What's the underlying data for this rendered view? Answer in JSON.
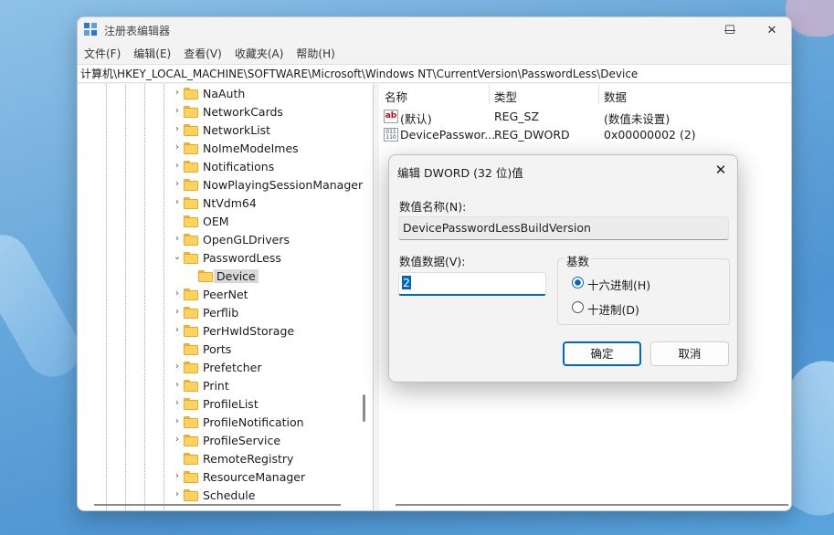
{
  "window": {
    "title": "注册表编辑器",
    "controls": {
      "minimize": "—",
      "maximize": "☐",
      "close": "✕"
    }
  },
  "menu": [
    "文件(F)",
    "编辑(E)",
    "查看(V)",
    "收藏夹(A)",
    "帮助(H)"
  ],
  "address": "计算机\\HKEY_LOCAL_MACHINE\\SOFTWARE\\Microsoft\\Windows NT\\CurrentVersion\\PasswordLess\\Device",
  "tree": {
    "items": [
      {
        "label": "NaAuth",
        "arrow": "›"
      },
      {
        "label": "NetworkCards",
        "arrow": "›"
      },
      {
        "label": "NetworkList",
        "arrow": "›"
      },
      {
        "label": "NoImeModeImes",
        "arrow": "›"
      },
      {
        "label": "Notifications",
        "arrow": "›"
      },
      {
        "label": "NowPlayingSessionManager",
        "arrow": "›"
      },
      {
        "label": "NtVdm64",
        "arrow": "›"
      },
      {
        "label": "OEM",
        "arrow": ""
      },
      {
        "label": "OpenGLDrivers",
        "arrow": "›"
      },
      {
        "label": "PasswordLess",
        "arrow": "⌄"
      },
      {
        "label": "Device",
        "arrow": ""
      },
      {
        "label": "PeerNet",
        "arrow": "›"
      },
      {
        "label": "Perflib",
        "arrow": "›"
      },
      {
        "label": "PerHwIdStorage",
        "arrow": "›"
      },
      {
        "label": "Ports",
        "arrow": ""
      },
      {
        "label": "Prefetcher",
        "arrow": "›"
      },
      {
        "label": "Print",
        "arrow": "›"
      },
      {
        "label": "ProfileList",
        "arrow": "›"
      },
      {
        "label": "ProfileNotification",
        "arrow": "›"
      },
      {
        "label": "ProfileService",
        "arrow": "›"
      },
      {
        "label": "RemoteRegistry",
        "arrow": ""
      },
      {
        "label": "ResourceManager",
        "arrow": "›"
      },
      {
        "label": "Schedule",
        "arrow": "›"
      }
    ]
  },
  "list": {
    "headers": {
      "name": "名称",
      "type": "类型",
      "data": "数据"
    },
    "rows": [
      {
        "icon": "ab",
        "name": "(默认)",
        "type": "REG_SZ",
        "data": "(数值未设置)"
      },
      {
        "icon": "011 110",
        "name": "DevicePasswor...",
        "type": "REG_DWORD",
        "data": "0x00000002 (2)"
      }
    ]
  },
  "dialog": {
    "title": "编辑 DWORD (32 位)值",
    "close": "✕",
    "name_label": "数值名称(N):",
    "name_value": "DevicePasswordLessBuildVersion",
    "data_label": "数值数据(V):",
    "data_value": "2",
    "radix_label": "基数",
    "radix_hex": "十六进制(H)",
    "radix_dec": "十进制(D)",
    "radix_selected": "hex",
    "ok": "确定",
    "cancel": "取消"
  },
  "colors": {
    "accent": "#0067c0",
    "folder": "#ffd25c"
  }
}
